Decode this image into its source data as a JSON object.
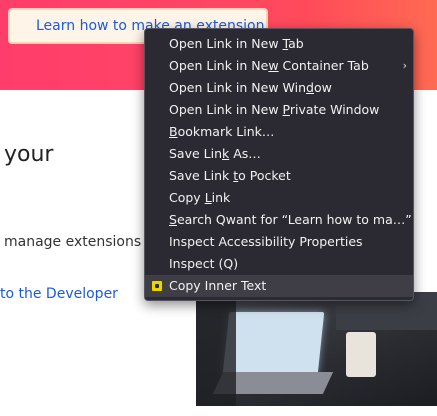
{
  "page": {
    "cta_label": "Learn how to make an extension",
    "heading": "your",
    "paragraph": "manage extensions",
    "link_text": "to the Developer"
  },
  "context_menu": {
    "items": [
      {
        "pre": "Open Link in New ",
        "u": "T",
        "post": "ab"
      },
      {
        "pre": "Open Link in Ne",
        "u": "w",
        "post": " Container Tab",
        "submenu_arrow": "›"
      },
      {
        "pre": "Open Link in New Win",
        "u": "d",
        "post": "ow"
      },
      {
        "pre": "Open Link in New ",
        "u": "P",
        "post": "rivate Window"
      },
      {
        "pre": "",
        "u": "B",
        "post": "ookmark Link…"
      },
      {
        "pre": "Save Lin",
        "u": "k",
        "post": " As…"
      },
      {
        "pre": "Save Link ",
        "u": "t",
        "post": "o Pocket"
      },
      {
        "pre": "Copy ",
        "u": "L",
        "post": "ink"
      },
      {
        "pre": "",
        "u": "S",
        "post": "earch Qwant for “Learn how to ma…”"
      },
      {
        "pre": "Inspect Accessibility Properties",
        "u": "",
        "post": ""
      },
      {
        "pre": "Inspect (Q)",
        "u": "",
        "post": ""
      },
      {
        "pre": "Copy Inner Text",
        "u": "",
        "post": "",
        "icon": "extension-icon"
      }
    ]
  },
  "colors": {
    "banner": "#ff4565",
    "menu_background": "#2b2a33",
    "link": "#1a5bd6"
  }
}
